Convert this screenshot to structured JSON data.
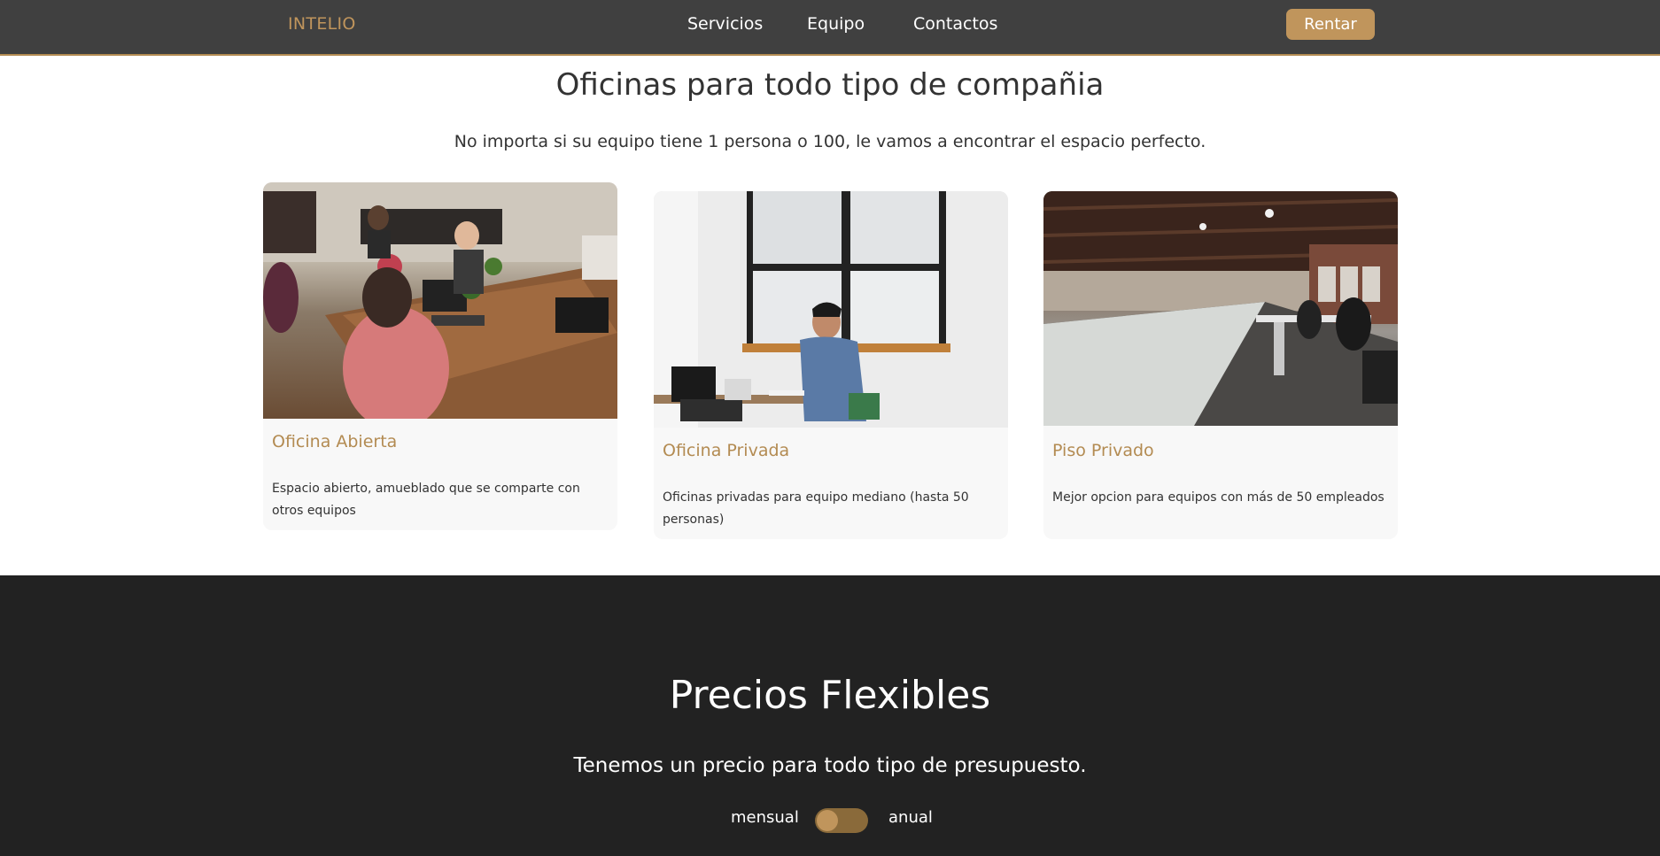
{
  "nav": {
    "brand": "INTELIO",
    "links": [
      "Servicios",
      "Equipo",
      "Contactos"
    ],
    "cta": "Rentar"
  },
  "offices": {
    "title": "Oficinas para todo tipo de compañia",
    "subtitle": "No importa si su equipo tiene 1 persona o 100, le vamos a encontrar el espacio perfecto.",
    "cards": [
      {
        "title": "Oficina Abierta",
        "description": "Espacio abierto, amueblado que se comparte con otros equipos",
        "image": "coworking-table-photo"
      },
      {
        "title": "Oficina Privada",
        "description": "Oficinas privadas para equipo mediano (hasta 50 personas)",
        "image": "man-at-desk-window-photo"
      },
      {
        "title": "Piso Privado",
        "description": "Mejor opcion para equipos con más de 50 empleados",
        "image": "open-floor-office-photo"
      }
    ]
  },
  "pricing": {
    "title": "Precios Flexibles",
    "subtitle": "Tenemos un precio para todo tipo de presupuesto.",
    "toggle_left": "mensual",
    "toggle_right": "anual"
  },
  "colors": {
    "accent": "#c0955c",
    "nav_bg": "#404040",
    "dark_bg": "#222222"
  }
}
